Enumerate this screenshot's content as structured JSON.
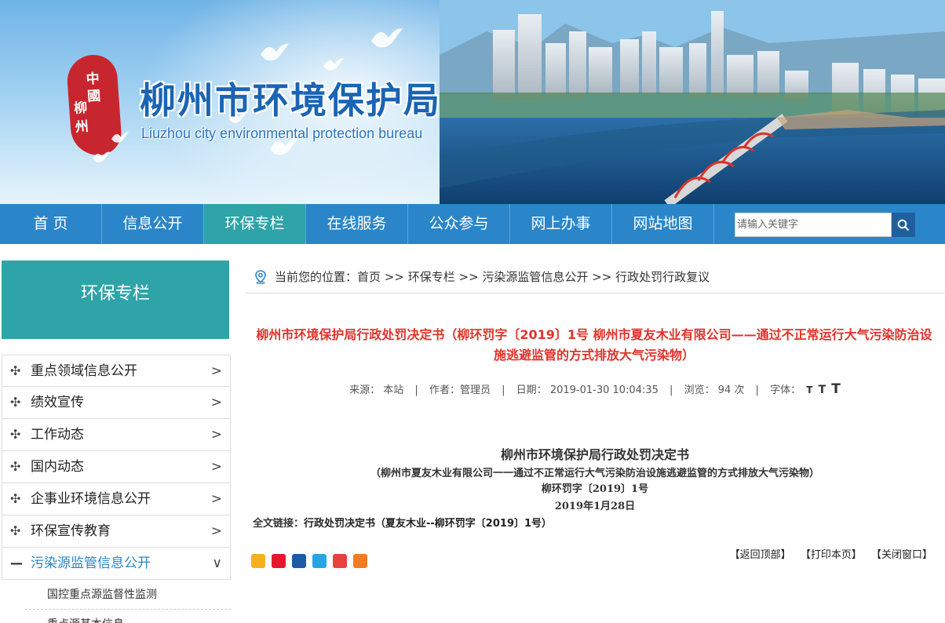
{
  "banner": {
    "title": "柳州市环境保护局",
    "subtitle": "Liuzhou city environmental protection bureau",
    "seal_chars": [
      "中",
      "國",
      "柳",
      "州"
    ]
  },
  "nav": {
    "items": [
      "首  页",
      "信息公开",
      "环保专栏",
      "在线服务",
      "公众参与",
      "网上办事",
      "网站地图"
    ],
    "active_index": 2
  },
  "search": {
    "placeholder": "请输入关键字",
    "icon": "search-icon"
  },
  "sidebar": {
    "heading": "环保专栏",
    "items": [
      {
        "label": "重点领域信息公开",
        "expanded": false
      },
      {
        "label": "绩效宣传",
        "expanded": false
      },
      {
        "label": "工作动态",
        "expanded": false
      },
      {
        "label": "国内动态",
        "expanded": false
      },
      {
        "label": "企事业环境信息公开",
        "expanded": false
      },
      {
        "label": "环保宣传教育",
        "expanded": false
      },
      {
        "label": "污染源监管信息公开",
        "expanded": true
      }
    ],
    "subitems": [
      "国控重点源监督性监测",
      "重点源基本信息"
    ]
  },
  "breadcrumb": {
    "prefix": "当前您的位置：",
    "items": [
      "首页",
      "环保专栏",
      "污染源监管信息公开",
      "行政处罚行政复议"
    ],
    "separator": " >> "
  },
  "article": {
    "title": "柳州市环境保护局行政处罚决定书（柳环罚字〔2019〕1号 柳州市夏友木业有限公司——通过不正常运行大气污染防治设施逃避监管的方式排放大气污染物）",
    "meta": {
      "source_label": "来源：",
      "source": "本站",
      "author_label": "作者：",
      "author": "管理员",
      "date_label": "日期：",
      "date": "2019-01-30 10:04:35",
      "views_label": "浏览：",
      "views": "94 次",
      "font_label": "字体：",
      "font_sizes": [
        "T",
        "T",
        "T"
      ]
    },
    "doc_title": "柳州市环境保护局行政处罚决定书",
    "doc_subtitle": "（柳州市夏友木业有限公司一一通过不正常运行大气污染防治设施逃避监管的方式排放大气污染物）",
    "doc_number": "柳环罚字〔2019〕1号",
    "doc_date": "2019年1月28日",
    "fulltext_label": "全文链接：",
    "fulltext_link": "行政处罚决定书（夏友木业--柳环罚字〔2019〕1号）"
  },
  "share_icons": [
    {
      "name": "qzone-share-icon",
      "color": "#f2b21d"
    },
    {
      "name": "weibo-share-icon",
      "color": "#e6162d"
    },
    {
      "name": "renren-share-icon",
      "color": "#1f5aa6"
    },
    {
      "name": "tqq-share-icon",
      "color": "#2aa3e0"
    },
    {
      "name": "qq-share-icon",
      "color": "#e9413d"
    },
    {
      "name": "more-share-icon",
      "color": "#f47b20"
    }
  ],
  "actions": [
    "【返回顶部】",
    "【打印本页】",
    "【关闭窗口】"
  ],
  "colors": {
    "nav": "#2a86c9",
    "accent": "#2ea4a8",
    "title_red": "#e0332b"
  }
}
